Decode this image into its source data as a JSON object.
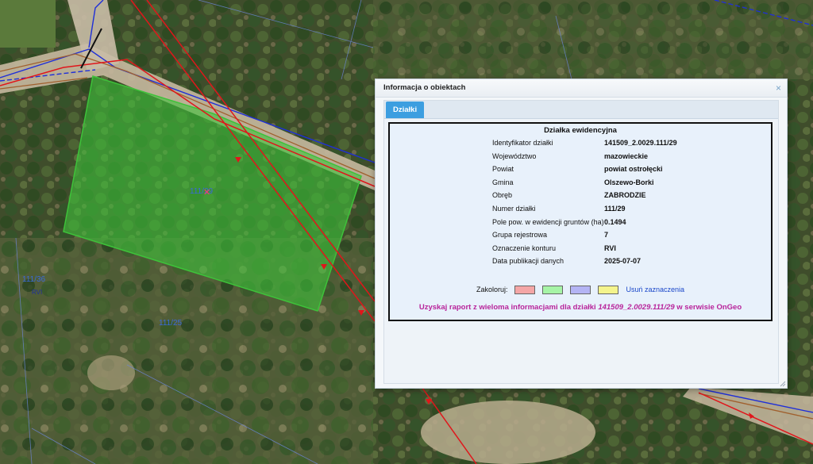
{
  "map": {
    "parcel_label": "111/29",
    "parcel_label_2": "111/29",
    "neighbor_label": "111/36",
    "neighbor_label_2": "RVI",
    "neighbor_label_3": "111/25"
  },
  "dialog": {
    "title": "Informacja o obiektach",
    "close_glyph": "×",
    "tab_label": "Działki",
    "card_title": "Działka ewidencyjna",
    "rows": [
      {
        "label": "Identyfikator działki",
        "value": "141509_2.0029.111/29"
      },
      {
        "label": "Województwo",
        "value": "mazowieckie"
      },
      {
        "label": "Powiat",
        "value": "powiat ostrołęcki"
      },
      {
        "label": "Gmina",
        "value": "Olszewo-Borki"
      },
      {
        "label": "Obręb",
        "value": "ZABRODZIE"
      },
      {
        "label": "Numer działki",
        "value": "111/29"
      },
      {
        "label": "Pole pow. w ewidencji gruntów (ha)",
        "value": "0.1494"
      },
      {
        "label": "Grupa rejestrowa",
        "value": "7"
      },
      {
        "label": "Oznaczenie konturu",
        "value": "RVI"
      },
      {
        "label": "Data publikacji danych",
        "value": "2025-07-07"
      }
    ],
    "colorize_label": "Zakoloruj:",
    "swatch_colors": [
      "#f4a6a6",
      "#a6f4a6",
      "#b4b4f4",
      "#f4f48c"
    ],
    "clear_selection": "Usuń zaznaczenia",
    "report_prefix": "Uzyskaj raport z wieloma informacjami dla działki ",
    "report_parcel": "141509_2.0029.111/29",
    "report_suffix": " w serwisie OnGeo"
  }
}
